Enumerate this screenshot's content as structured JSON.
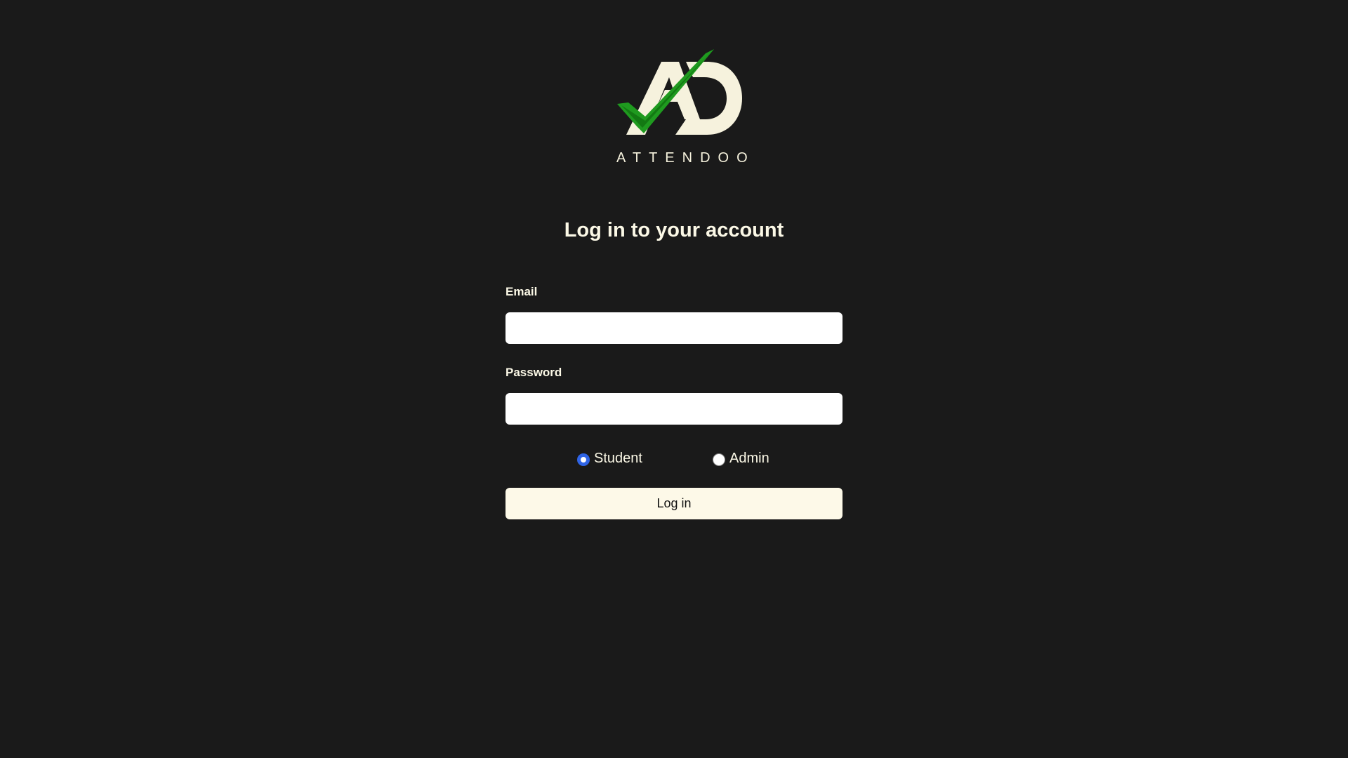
{
  "app": {
    "brand_name": "ATTENDOO",
    "logo_icon": "ad-monogram-checkmark-logo"
  },
  "main": {
    "title": "Log in to your account"
  },
  "form": {
    "email_label": "Email",
    "email_value": "",
    "email_placeholder": "",
    "password_label": "Password",
    "password_value": "",
    "password_placeholder": "",
    "roles": [
      {
        "label": "Student",
        "checked": true
      },
      {
        "label": "Admin",
        "checked": false
      }
    ],
    "submit_label": "Log in"
  },
  "colors": {
    "background": "#1a1a1a",
    "text": "#fbf8e6",
    "button_bg": "#fdf9e8",
    "radio_accent": "#2f64e6",
    "logo_cream": "#f6f2dd",
    "logo_green": "#1f9a1f"
  }
}
